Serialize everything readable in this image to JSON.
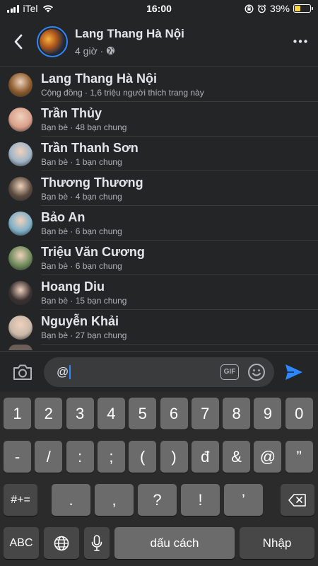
{
  "status_bar": {
    "carrier": "iTel",
    "time": "16:00",
    "battery": "39%",
    "battery_level": 0.39
  },
  "header": {
    "title": "Lang Thang Hà Nội",
    "subtitle": "4 giờ ·"
  },
  "mentions": [
    {
      "name": "Lang Thang Hà Nội",
      "meta": "Cộng đồng · 1,6 triệu người thích trang này",
      "color": "#8a5a2b"
    },
    {
      "name": "Trần Thủy",
      "meta": "Bạn bè · 48 bạn chung",
      "color": "#d9a08b"
    },
    {
      "name": "Trần Thanh Sơn",
      "meta": "Bạn bè · 1 bạn chung",
      "color": "#9fb4c8"
    },
    {
      "name": "Thương Thương",
      "meta": "Bạn bè · 4 bạn chung",
      "color": "#5a4a3e"
    },
    {
      "name": "Bảo An",
      "meta": "Bạn bè · 6 bạn chung",
      "color": "#7fb0c8"
    },
    {
      "name": "Triệu Văn Cương",
      "meta": "Bạn bè · 6 bạn chung",
      "color": "#6d8a5a"
    },
    {
      "name": "Hoang Diu",
      "meta": "Bạn bè · 15 bạn chung",
      "color": "#3a3030"
    },
    {
      "name": "Nguyễn Khải",
      "meta": "Bạn bè · 27 bạn chung",
      "color": "#c9b8a8"
    }
  ],
  "composer": {
    "value": "@",
    "gif_label": "GIF"
  },
  "keyboard": {
    "row1": [
      "1",
      "2",
      "3",
      "4",
      "5",
      "6",
      "7",
      "8",
      "9",
      "0"
    ],
    "row2": [
      "-",
      "/",
      ":",
      ";",
      "(",
      ")",
      "đ",
      "&",
      "@",
      "”"
    ],
    "row3_left": "#+=",
    "row3": [
      ".",
      ",",
      "?",
      "!",
      "’"
    ],
    "row4": {
      "abc": "ABC",
      "space": "dấu cách",
      "enter": "Nhập"
    }
  },
  "colors": {
    "accent": "#2d88ff",
    "background": "#242526",
    "divider": "#3a3b3c"
  }
}
